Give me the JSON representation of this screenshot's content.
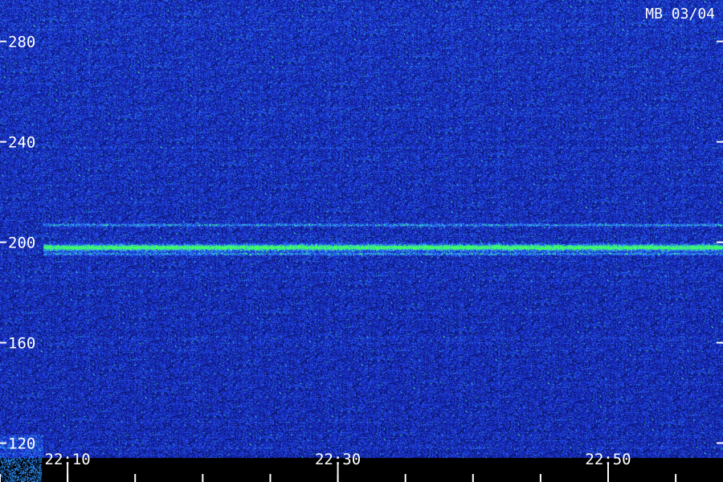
{
  "chart_data": {
    "type": "heatmap",
    "title": "",
    "station_label": "MB 03/04",
    "xlabel": "",
    "ylabel": "",
    "x_ticks": [
      {
        "label": "22:10",
        "minutes": 10
      },
      {
        "label": "22:30",
        "minutes": 30
      },
      {
        "label": "22:50",
        "minutes": 50
      }
    ],
    "xlim": [
      5.0,
      58.5
    ],
    "minor_tick_step_minutes": 5,
    "y_ticks": [
      {
        "label": "280",
        "value": 280
      },
      {
        "label": "240",
        "value": 240
      },
      {
        "label": "200",
        "value": 200
      },
      {
        "label": "160",
        "value": 160
      },
      {
        "label": "120",
        "value": 120
      }
    ],
    "ylim": [
      104.5,
      296.5
    ],
    "recording_start_minutes": 8.2,
    "features": [
      {
        "name": "carrier",
        "value": 198,
        "intensity": "high",
        "color": "#40ff60"
      },
      {
        "name": "sideband-upper",
        "value": 207,
        "intensity": "medium",
        "color": "#20c8ff"
      },
      {
        "name": "sideband-lower",
        "value": 195.5,
        "intensity": "medium",
        "color": "#20c8ff"
      }
    ],
    "colors": {
      "background": "#000000",
      "noise_low": "#0a1470",
      "noise_mid": "#2038e8",
      "noise_high": "#30a8ff",
      "peak": "#40ff60",
      "text": "#ffffff"
    }
  }
}
